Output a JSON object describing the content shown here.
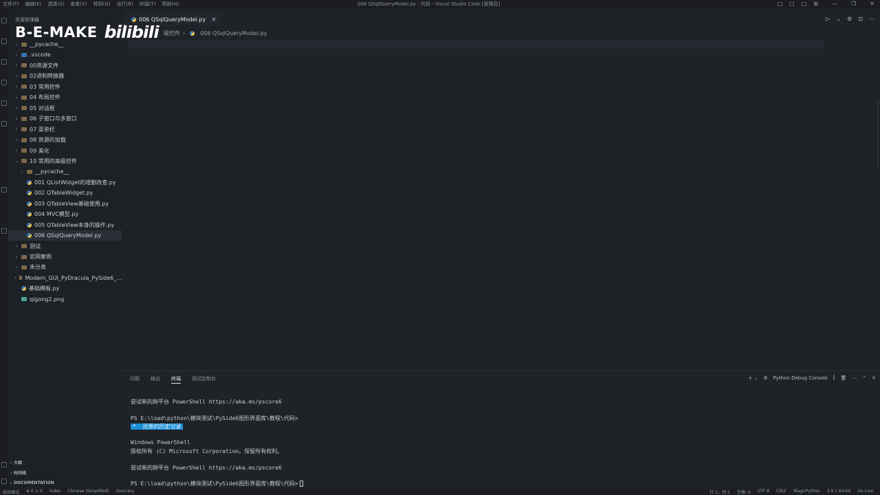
{
  "titlebar": {
    "menu": [
      "文件(F)",
      "编辑(E)",
      "选择(S)",
      "查看(V)",
      "转到(G)",
      "运行(R)",
      "终端(T)",
      "帮助(H)"
    ],
    "window_title": "006 QSqlQueryModel.py - 代码 - Visual Studio Code [管理员]",
    "layout_icons": [
      "□",
      "□",
      "□",
      "⊞"
    ],
    "window_controls": [
      "—",
      "❐",
      "✕"
    ]
  },
  "sidebar": {
    "title": "资源管理器",
    "items": [
      {
        "label": "__pycache__",
        "type": "folder",
        "indent": 1,
        "chevron": "›",
        "selected": false
      },
      {
        "label": ".vscode",
        "type": "vscode",
        "indent": 1,
        "chevron": "›",
        "selected": false
      },
      {
        "label": "00资源文件",
        "type": "folder",
        "indent": 1,
        "chevron": "›",
        "selected": false
      },
      {
        "label": "02进制转换器",
        "type": "folder",
        "indent": 1,
        "chevron": "›",
        "selected": false
      },
      {
        "label": "03 常用控件",
        "type": "folder",
        "indent": 1,
        "chevron": "›",
        "selected": false
      },
      {
        "label": "04 布局控件",
        "type": "folder",
        "indent": 1,
        "chevron": "›",
        "selected": false
      },
      {
        "label": "05 对话框",
        "type": "folder",
        "indent": 1,
        "chevron": "›",
        "selected": false
      },
      {
        "label": "06 子窗口与多窗口",
        "type": "folder",
        "indent": 1,
        "chevron": "›",
        "selected": false
      },
      {
        "label": "07 菜单栏",
        "type": "folder",
        "indent": 1,
        "chevron": "›",
        "selected": false
      },
      {
        "label": "08 资源的加载",
        "type": "folder",
        "indent": 1,
        "chevron": "›",
        "selected": false
      },
      {
        "label": "09 美化",
        "type": "folder",
        "indent": 1,
        "chevron": "›",
        "selected": false
      },
      {
        "label": "10 常用的高级控件",
        "type": "folder",
        "indent": 1,
        "chevron": "⌄",
        "selected": false
      },
      {
        "label": "__pycache__",
        "type": "folder",
        "indent": 2,
        "chevron": "›",
        "selected": false
      },
      {
        "label": "001 QListWidget的增删改查.py",
        "type": "py",
        "indent": 2,
        "chevron": "",
        "selected": false
      },
      {
        "label": "002 QTableWidget.py",
        "type": "py",
        "indent": 2,
        "chevron": "",
        "selected": false
      },
      {
        "label": "003 QTableView基础使用.py",
        "type": "py",
        "indent": 2,
        "chevron": "",
        "selected": false
      },
      {
        "label": "004 MVC模型.py",
        "type": "py",
        "indent": 2,
        "chevron": "",
        "selected": false
      },
      {
        "label": "005 QTableView本身的操作.py",
        "type": "py",
        "indent": 2,
        "chevron": "",
        "selected": false
      },
      {
        "label": "006 QSqlQueryModel.py",
        "type": "py",
        "indent": 2,
        "chevron": "",
        "selected": true
      },
      {
        "label": "测试",
        "type": "folder",
        "indent": 1,
        "chevron": "›",
        "selected": false
      },
      {
        "label": "官网案例",
        "type": "folder",
        "indent": 1,
        "chevron": "›",
        "selected": false
      },
      {
        "label": "未分类",
        "type": "folder",
        "indent": 1,
        "chevron": "›",
        "selected": false
      },
      {
        "label": "Modern_GUI_PyDracula_PySide6_...",
        "type": "folder",
        "indent": 1,
        "chevron": "›",
        "selected": false
      },
      {
        "label": "基础模板.py",
        "type": "py",
        "indent": 1,
        "chevron": "",
        "selected": false
      },
      {
        "label": "qigong2.png",
        "type": "png",
        "indent": 1,
        "chevron": "",
        "selected": false
      }
    ],
    "bottom_sections": [
      "大纲",
      "时间线",
      "DOCUMENTATION"
    ]
  },
  "watermark": {
    "text": "B-E-MAKE",
    "logo": "bilibili"
  },
  "editor": {
    "tab_label": "006 QSqlQueryModel.py",
    "tab_close": "×",
    "breadcrumb": [
      "级控件",
      "006 QSqlQueryModel.py"
    ],
    "run_controls": [
      "▷",
      "⌄",
      "⚙",
      "⊡",
      "⋯"
    ]
  },
  "panel": {
    "tabs": [
      "问题",
      "输出",
      "终端",
      "调试控制台"
    ],
    "active_tab": "终端",
    "controls": {
      "add": "+ ⌄",
      "terminal_name": "Python Debug Console",
      "icons": [
        "⫿",
        "🗑",
        "⋯",
        "⌃",
        "✕"
      ]
    },
    "terminal_lines": [
      "尝试新的跨平台 PowerShell https://aka.ms/pscore6",
      "PS E:\\load\\python\\模块测试\\PySide6图形界面库\\教程\\代码>",
      "还原的历史记录",
      "Windows PowerShell",
      "版权所有 (C) Microsoft Corporation。保留所有权利。",
      "尝试新的跨平台 PowerShell https://aka.ms/pscore6",
      "PS E:\\load\\python\\模块测试\\PySide6图形界面库\\教程\\代码>"
    ],
    "highlight_prefix": "*"
  },
  "statusbar": {
    "left": [
      "启动调试",
      "⊗ 0  ⚠ 0",
      "Index",
      "Chinese (Simplified)",
      "Sourcery"
    ],
    "right": [
      "行 1，列 1",
      "空格: 4",
      "UTF-8",
      "CRLF",
      "MagicPython",
      "3.9.1 64-bit",
      "Go Live"
    ]
  }
}
